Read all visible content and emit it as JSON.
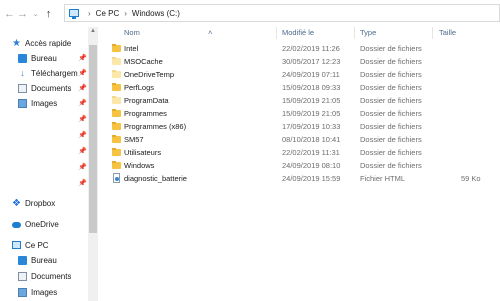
{
  "address": {
    "back_icon": "back-arrow-icon",
    "forward_icon": "forward-arrow-icon",
    "recent_icon": "chevron-down-icon",
    "up_icon": "up-arrow-icon",
    "breadcrumb": [
      "Ce PC",
      "Windows (C:)"
    ]
  },
  "sidebar": {
    "quick_access": "Accès rapide",
    "quick_items": [
      {
        "label": "Bureau",
        "icon": "desktop-icon"
      },
      {
        "label": "Téléchargem",
        "icon": "download-icon"
      },
      {
        "label": "Documents",
        "icon": "documents-icon"
      },
      {
        "label": "Images",
        "icon": "images-icon"
      }
    ],
    "dropbox": "Dropbox",
    "onedrive": "OneDrive",
    "this_pc": "Ce PC",
    "pc_items": [
      {
        "label": "Bureau",
        "icon": "desktop-icon"
      },
      {
        "label": "Documents",
        "icon": "documents-icon"
      },
      {
        "label": "Images",
        "icon": "images-icon"
      }
    ]
  },
  "columns": {
    "name": "Nom",
    "modified": "Modifié le",
    "type": "Type",
    "size": "Taille"
  },
  "files": [
    {
      "name": "Intel",
      "modified": "22/02/2019 11:26",
      "type": "Dossier de fichiers",
      "size": "",
      "icon": "folder-icon"
    },
    {
      "name": "MSOCache",
      "modified": "30/05/2017 12:23",
      "type": "Dossier de fichiers",
      "size": "",
      "icon": "folder-hidden-icon"
    },
    {
      "name": "OneDriveTemp",
      "modified": "24/09/2019 07:11",
      "type": "Dossier de fichiers",
      "size": "",
      "icon": "folder-hidden-icon"
    },
    {
      "name": "PerfLogs",
      "modified": "15/09/2018 09:33",
      "type": "Dossier de fichiers",
      "size": "",
      "icon": "folder-icon"
    },
    {
      "name": "ProgramData",
      "modified": "15/09/2019 21:05",
      "type": "Dossier de fichiers",
      "size": "",
      "icon": "folder-hidden-icon"
    },
    {
      "name": "Programmes",
      "modified": "15/09/2019 21:05",
      "type": "Dossier de fichiers",
      "size": "",
      "icon": "folder-icon"
    },
    {
      "name": "Programmes (x86)",
      "modified": "17/09/2019 10:33",
      "type": "Dossier de fichiers",
      "size": "",
      "icon": "folder-icon"
    },
    {
      "name": "SM57",
      "modified": "08/10/2018 10:41",
      "type": "Dossier de fichiers",
      "size": "",
      "icon": "folder-icon"
    },
    {
      "name": "Utilisateurs",
      "modified": "22/02/2019 11:31",
      "type": "Dossier de fichiers",
      "size": "",
      "icon": "folder-icon"
    },
    {
      "name": "Windows",
      "modified": "24/09/2019 08:10",
      "type": "Dossier de fichiers",
      "size": "",
      "icon": "folder-icon"
    },
    {
      "name": "diagnostic_batterie",
      "modified": "24/09/2019 15:59",
      "type": "Fichier HTML",
      "size": "59 Ko",
      "icon": "html-file-icon"
    }
  ]
}
